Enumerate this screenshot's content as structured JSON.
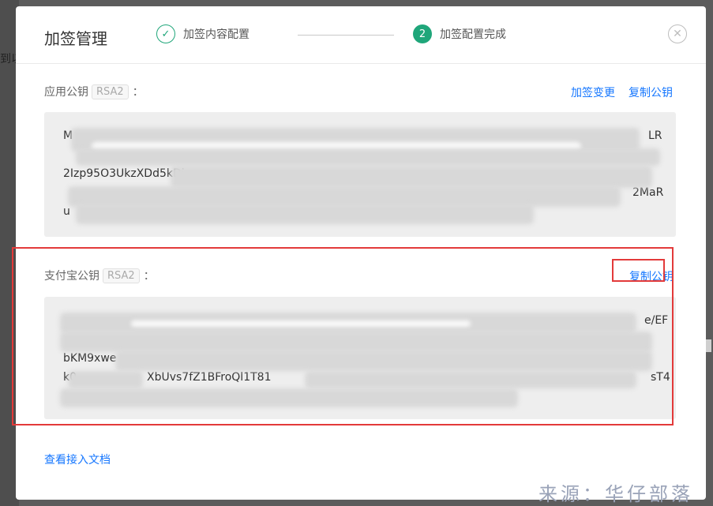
{
  "backdrop": {
    "text": "到以"
  },
  "modal": {
    "title": "加签管理",
    "steps": [
      {
        "index": "✓",
        "label": "加签内容配置",
        "state": "done"
      },
      {
        "index": "2",
        "label": "加签配置完成",
        "state": "active"
      }
    ],
    "close_label": "✕"
  },
  "app_key": {
    "label": "应用公钥",
    "badge": "RSA2",
    "colon": "：",
    "action_change": "加签变更",
    "action_copy": "复制公钥",
    "lines": [
      "M",
      "2Izp95O3UkzXDd5kDi",
      "",
      "u"
    ],
    "line_tails": [
      "LR",
      "",
      "",
      "2MaR"
    ]
  },
  "alipay_key": {
    "label": "支付宝公钥",
    "badge": "RSA2",
    "colon": "：",
    "action_copy": "复制公钥",
    "lines": [
      "",
      "",
      "bKM9xwe",
      "k0",
      ""
    ],
    "line_middles": [
      "",
      "",
      "",
      "XbUvs7fZ1BFroQl1T81",
      ""
    ],
    "line_tails": [
      "e/EF",
      "",
      "",
      "sT4",
      ""
    ]
  },
  "doc_link": "查看接入文档",
  "watermark": "来源：华仔部落",
  "colors": {
    "accent_green": "#1fa67a",
    "link_blue": "#1677ff",
    "highlight_red": "#e33a3a"
  }
}
